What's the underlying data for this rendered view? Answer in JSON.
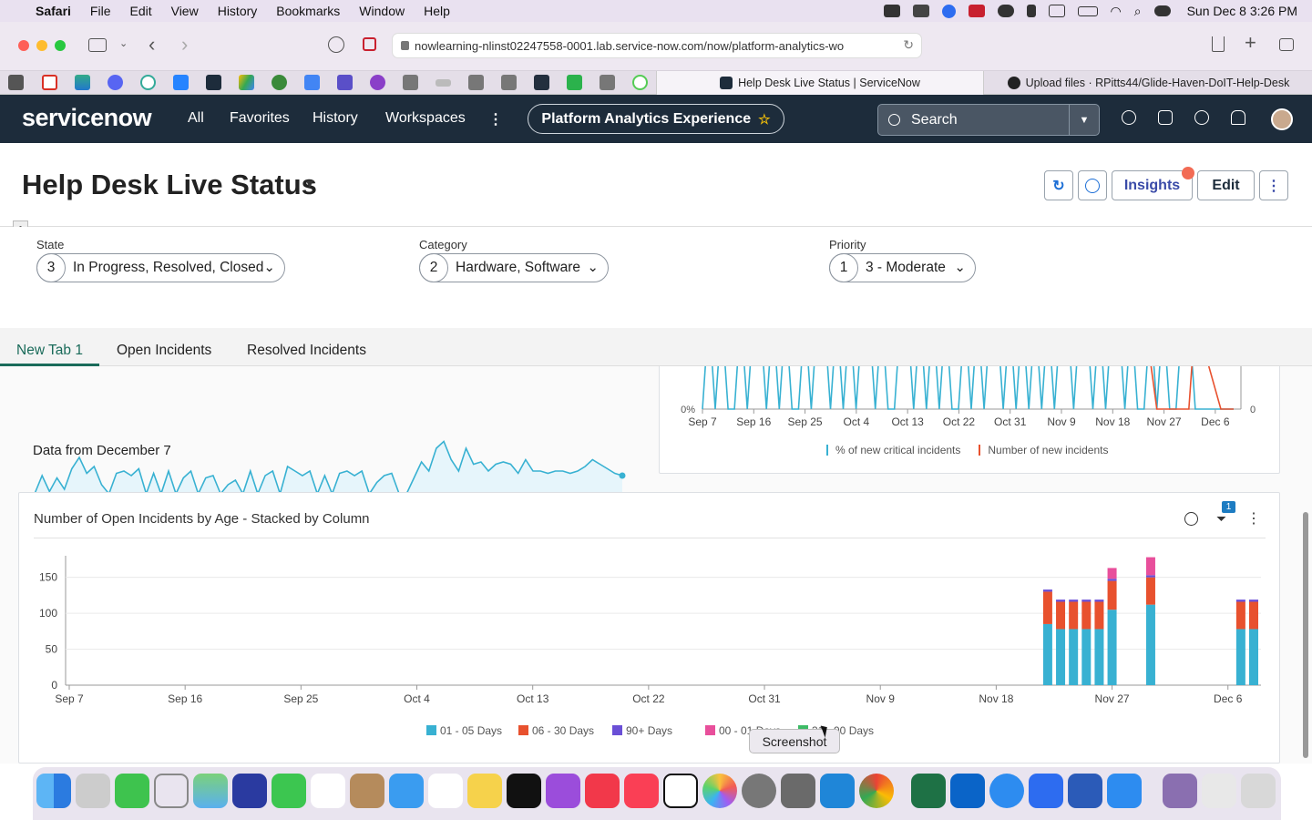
{
  "menubar": {
    "items": [
      "Safari",
      "File",
      "Edit",
      "View",
      "History",
      "Bookmarks",
      "Window",
      "Help"
    ],
    "clock": "Sun Dec 8  3:26 PM"
  },
  "browser": {
    "url": "nowlearning-nlinst02247558-0001.lab.service-now.com/now/platform-analytics-wo",
    "tabs": [
      "Help Desk Live Status | ServiceNow",
      "Upload files · RPitts44/Glide-Haven-DoIT-Help-Desk"
    ]
  },
  "header": {
    "logo": "servicenow",
    "nav": [
      "All",
      "Favorites",
      "History",
      "Workspaces"
    ],
    "workspace_pill": "Platform Analytics Experience",
    "search_placeholder": "Search"
  },
  "page": {
    "title": "Help Desk Live Status",
    "insights_label": "Insights",
    "edit_label": "Edit"
  },
  "filters": [
    {
      "label": "State",
      "count": "3",
      "value": "In Progress, Resolved, Closed"
    },
    {
      "label": "Category",
      "count": "2",
      "value": "Hardware, Software"
    },
    {
      "label": "Priority",
      "count": "1",
      "value": "3 - Moderate"
    }
  ],
  "tabs": [
    "New Tab 1",
    "Open Incidents",
    "Resolved Incidents"
  ],
  "sparkline_card": {
    "caption": "Data from December 7",
    "values": [
      0.1,
      0.5,
      0.15,
      0.45,
      0.2,
      0.65,
      0.9,
      0.55,
      0.7,
      0.3,
      0.1,
      0.55,
      0.6,
      0.5,
      0.65,
      0.1,
      0.55,
      0.1,
      0.6,
      0.1,
      0.45,
      0.6,
      0.1,
      0.45,
      0.5,
      0.1,
      0.3,
      0.4,
      0.1,
      0.6,
      0.1,
      0.5,
      0.6,
      0.1,
      0.7,
      0.6,
      0.5,
      0.6,
      0.1,
      0.5,
      0.1,
      0.55,
      0.6,
      0.5,
      0.6,
      0.1,
      0.35,
      0.5,
      0.55,
      0.1,
      0.1,
      0.45,
      0.8,
      0.6,
      1.1,
      1.25,
      0.85,
      0.6,
      1.1,
      0.75,
      0.8,
      0.6,
      0.75,
      0.8,
      0.75,
      0.55,
      0.85,
      0.6,
      0.6,
      0.55,
      0.6,
      0.6,
      0.55,
      0.6,
      0.7,
      0.85,
      0.75,
      0.65,
      0.55,
      0.5
    ]
  },
  "combo_chart": {
    "y_left_tick": "0%",
    "y_left_top_tick": "0%",
    "y_right_tick": "0",
    "x_ticks": [
      "Sep 7",
      "Sep 16",
      "Sep 25",
      "Oct 4",
      "Oct 13",
      "Oct 22",
      "Oct 31",
      "Nov 9",
      "Nov 18",
      "Nov 27",
      "Dec 6"
    ],
    "legend": [
      {
        "name": "% of new critical incidents",
        "color": "#38b1d2"
      },
      {
        "name": "Number of new incidents",
        "color": "#e8512e"
      }
    ],
    "pattern": [
      0,
      1,
      0,
      1,
      0,
      0,
      1,
      0,
      1,
      1,
      0,
      1,
      0,
      1,
      0,
      0,
      1,
      0,
      1,
      1,
      0,
      1,
      0,
      1,
      0,
      1,
      1,
      0,
      1,
      0,
      0,
      1,
      1,
      0,
      1,
      0,
      1,
      0,
      1,
      0,
      0,
      1,
      0,
      1,
      0,
      1,
      1,
      0,
      1,
      0,
      1,
      0,
      1,
      0,
      1,
      0,
      1,
      1,
      0,
      1,
      1,
      0,
      1,
      0,
      1,
      1,
      0,
      1,
      0,
      0,
      1,
      0,
      1,
      0,
      0,
      1,
      1,
      0,
      0,
      0,
      0,
      0,
      0,
      0
    ]
  },
  "stacked_card": {
    "title": "Number of Open Incidents by Age - Stacked by Column",
    "filter_badge": "1"
  },
  "chart_data": {
    "type": "bar",
    "title": "Number of Open Incidents by Age - Stacked by Column",
    "x_ticks": [
      "Sep 7",
      "Sep 16",
      "Sep 25",
      "Oct 4",
      "Oct 13",
      "Oct 22",
      "Oct 31",
      "Nov 9",
      "Nov 18",
      "Nov 27",
      "Dec 6"
    ],
    "y_ticks": [
      0,
      50,
      100,
      150
    ],
    "ylim": [
      0,
      180
    ],
    "xlim_days": [
      0,
      92
    ],
    "categories": [
      "Nov 22",
      "Nov 23",
      "Nov 24",
      "Nov 25",
      "Nov 26",
      "Nov 27",
      "Nov 30",
      "Dec 5",
      "Dec 6"
    ],
    "day_index": [
      76,
      77,
      78,
      79,
      80,
      81,
      84,
      91,
      92
    ],
    "series": [
      {
        "name": "01 - 05 Days",
        "color": "#38b1d2",
        "values": [
          85,
          78,
          78,
          78,
          78,
          105,
          112,
          78,
          78
        ]
      },
      {
        "name": "06 - 30 Days",
        "color": "#e8512e",
        "values": [
          45,
          38,
          38,
          38,
          38,
          40,
          38,
          38,
          38
        ]
      },
      {
        "name": "90+ Days",
        "color": "#6a4fd6",
        "values": [
          3,
          3,
          3,
          3,
          3,
          3,
          3,
          3,
          3
        ]
      },
      {
        "name": "00 - 01 Days",
        "color": "#e84f9b",
        "values": [
          0,
          0,
          0,
          0,
          0,
          15,
          25,
          0,
          0
        ]
      },
      {
        "name": "31 - 90 Days",
        "color": "#3dbb66",
        "values": [
          0,
          0,
          0,
          0,
          0,
          0,
          0,
          0,
          0
        ]
      }
    ],
    "legend": [
      "01 - 05 Days",
      "06 - 30 Days",
      "90+ Days",
      "00 - 01 Days",
      "31 - 90 Days"
    ]
  },
  "tooltip": "Screenshot"
}
